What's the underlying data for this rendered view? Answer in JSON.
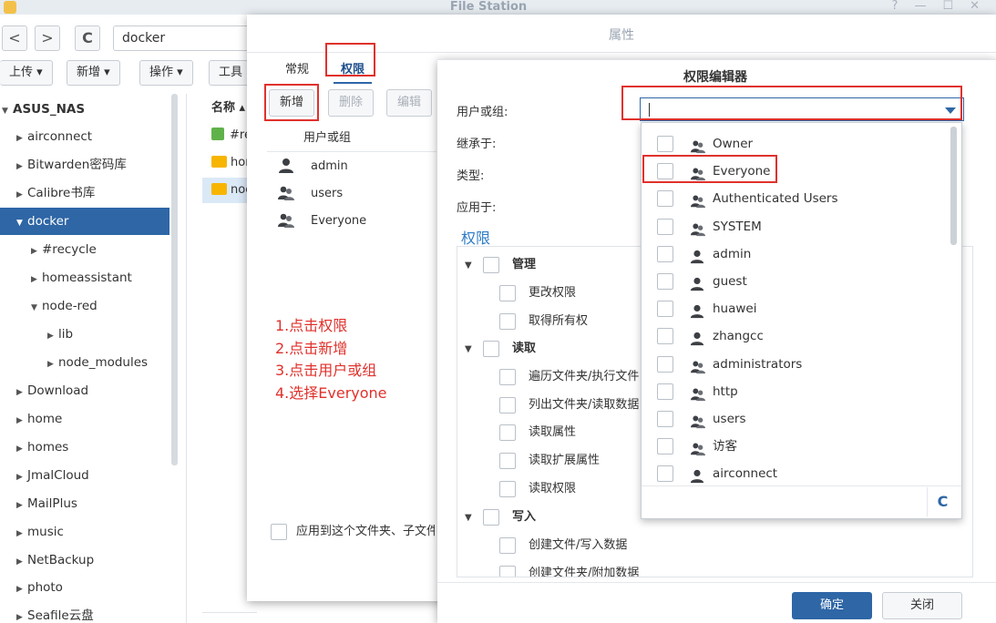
{
  "app": {
    "title": "File Station",
    "window_controls": [
      "?",
      "—",
      "☐",
      "✕"
    ]
  },
  "toolbar": {
    "back": "<",
    "forward": ">",
    "refresh": "C",
    "path": "docker"
  },
  "actions": {
    "upload": "上传 ▾",
    "create": "新增 ▾",
    "operate": "操作 ▾",
    "tools": "工具"
  },
  "sidebar": {
    "root": "ASUS_NAS",
    "items": [
      "airconnect",
      "Bitwarden密码库",
      "Calibre书库",
      "docker",
      "#recycle",
      "homeassistant",
      "node-red",
      "lib",
      "node_modules",
      "Download",
      "home",
      "homes",
      "JmalCloud",
      "MailPlus",
      "music",
      "NetBackup",
      "photo",
      "Seafile云盘"
    ]
  },
  "files": {
    "name_header": "名称 ▴",
    "rows": [
      "#re",
      "hon",
      "noc"
    ]
  },
  "properties": {
    "title": "属性",
    "tabs": [
      "常规",
      "权限"
    ],
    "buttons": {
      "add": "新增",
      "delete": "删除",
      "edit": "编辑"
    },
    "column_header": "用户或组",
    "users": [
      "admin",
      "users",
      "Everyone"
    ],
    "instructions": [
      "1.点击权限",
      "2.点击新增",
      "3.点击用户或组",
      "4.选择Everyone"
    ],
    "apply_sub": "应用到这个文件夹、子文件"
  },
  "editor": {
    "title": "权限编辑器",
    "labels": {
      "user_or_group": "用户或组:",
      "inherit": "继承于:",
      "type": "类型:",
      "apply_to": "应用于:"
    },
    "section": "权限",
    "groups": [
      {
        "name": "管理",
        "items": [
          "更改权限",
          "取得所有权"
        ]
      },
      {
        "name": "读取",
        "items": [
          "遍历文件夹/执行文件",
          "列出文件夹/读取数据",
          "读取属性",
          "读取扩展属性",
          "读取权限"
        ]
      },
      {
        "name": "写入",
        "items": [
          "创建文件/写入数据",
          "创建文件夹/附加数据"
        ]
      }
    ],
    "ok": "确定",
    "close": "关闭"
  },
  "dropdown": {
    "items": [
      {
        "name": "Owner",
        "icon": "group-icon"
      },
      {
        "name": "Everyone",
        "icon": "group-icon"
      },
      {
        "name": "Authenticated Users",
        "icon": "group-icon"
      },
      {
        "name": "SYSTEM",
        "icon": "group-icon"
      },
      {
        "name": "admin",
        "icon": "user-icon"
      },
      {
        "name": "guest",
        "icon": "user-icon"
      },
      {
        "name": "huawei",
        "icon": "user-icon"
      },
      {
        "name": "zhangcc",
        "icon": "user-icon"
      },
      {
        "name": "administrators",
        "icon": "group-icon"
      },
      {
        "name": "http",
        "icon": "group-icon"
      },
      {
        "name": "users",
        "icon": "group-icon"
      },
      {
        "name": "访客",
        "icon": "group-icon"
      },
      {
        "name": "airconnect",
        "icon": "user-icon"
      }
    ],
    "refresh": "C"
  },
  "colors": {
    "accent": "#2e66a6",
    "highlight": "#e0312c",
    "folder": "#f7b500"
  }
}
